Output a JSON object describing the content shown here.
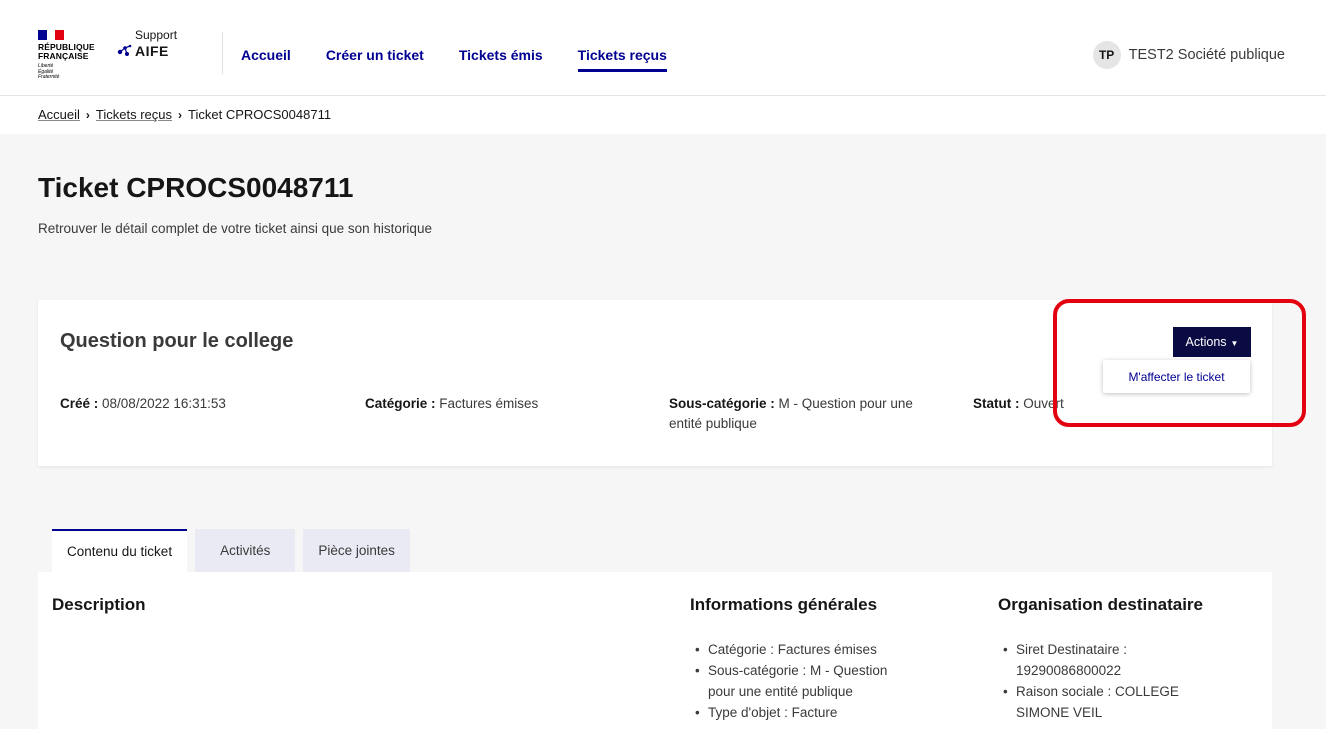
{
  "header": {
    "rf_logo": {
      "line1": "RÉPUBLIQUE",
      "line2": "FRANÇAISE",
      "motto": [
        "Liberté",
        "Égalité",
        "Fraternité"
      ]
    },
    "aife_logo": {
      "support": "Support",
      "name": "AIFE"
    },
    "nav": [
      "Accueil",
      "Créer un ticket",
      "Tickets émis",
      "Tickets reçus"
    ],
    "active_nav": "Tickets reçus",
    "user": {
      "initials": "TP",
      "name": "TEST2 Société publique"
    },
    "colors": {
      "brand_blue": "#000091",
      "red": "#e1000f"
    }
  },
  "breadcrumb": {
    "items": [
      "Accueil",
      "Tickets reçus"
    ],
    "current": "Ticket CPROCS0048711",
    "separator": "›"
  },
  "banner": {
    "title": "Ticket CPROCS0048711",
    "subtitle": "Retrouver le détail complet de votre ticket ainsi que son historique"
  },
  "ticket": {
    "title": "Question pour le college",
    "created_label": "Créé :",
    "created_value": "08/08/2022 16:31:53",
    "category_label": "Catégorie :",
    "category_value": "Factures émises",
    "subcategory_label": "Sous-catégorie :",
    "subcategory_value": "M - Question pour une",
    "subcategory_value_line2": "entité publique",
    "status_label": "Statut :",
    "status_value": "Ouvert",
    "actions_label": "Actions",
    "dropdown_item": "M'affecter le ticket"
  },
  "tabs": [
    "Contenu du ticket",
    "Activités",
    "Pièce jointes"
  ],
  "active_tab": "Contenu du ticket",
  "content": {
    "description_title": "Description",
    "general_title": "Informations générales",
    "general_items": [
      "Catégorie : Factures émises",
      "Sous-catégorie : M - Question",
      "pour une entité publique",
      "Type d'objet : Facture"
    ],
    "org_title": "Organisation destinataire",
    "org_items": [
      "Siret Destinataire :",
      "19290086800022",
      "Raison sociale : COLLEGE",
      "SIMONE VEIL"
    ]
  }
}
